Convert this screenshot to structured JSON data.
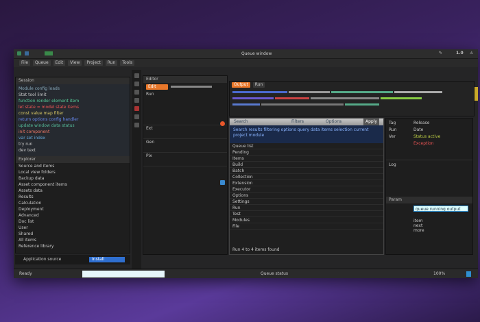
{
  "window": {
    "title": "Queue window",
    "title_icons": [
      "edit-icon",
      "user-icon",
      "alert-icon"
    ],
    "badge": "1.0"
  },
  "menu": [
    "File",
    "Queue",
    "Edit",
    "View",
    "Project",
    "Run",
    "Tools"
  ],
  "left": {
    "header": "Session",
    "tab": "Explorer",
    "code": [
      "Module config loads",
      "Stat tool limit",
      "function render element item",
      "let state = model state items",
      "const value map filter",
      "return options config handler",
      "update window data status",
      "init component",
      "var set index",
      "try run",
      "dev text"
    ],
    "tree": [
      "Source and items",
      "Local view folders",
      "Backup data",
      "Asset component items",
      "Assets data",
      "Results",
      "Calculation",
      "Deployment",
      "Advanced",
      "Doc list",
      "User",
      "Shared",
      "All items",
      "Reference library"
    ],
    "footer": "Application source",
    "footer_button": "Install"
  },
  "middle": {
    "header": "Editor",
    "tab": "Edit",
    "labels": [
      "Run",
      "Ext",
      "Gen",
      "Pix"
    ],
    "colors": {
      "accent": "#e8772a"
    }
  },
  "center": {
    "header": "Queue window",
    "tab": "Output",
    "tab2": "Run",
    "dialog": {
      "tabs": [
        "Search",
        "Filters",
        "Options"
      ],
      "button": "Apply",
      "selected": "Search results filtering options query data items selection current project module",
      "items": [
        "Queue list",
        "Pending",
        "Items",
        "Build",
        "Batch",
        "Collection",
        "Extension",
        "Executor",
        "Options",
        "Settings",
        "Run",
        "Test",
        "Modules",
        "File"
      ],
      "footer": "Run 4 to 4 items found"
    }
  },
  "right": {
    "labels": [
      "Tag",
      "Run",
      "Ver",
      "Log",
      "Param"
    ],
    "values": [
      "Release",
      "Date",
      "Status active",
      "Exception"
    ],
    "input": "queue running output value",
    "list": [
      "item",
      "next",
      "more"
    ]
  },
  "status": {
    "left": "Ready",
    "center": "Queue status",
    "right": "100%"
  },
  "colors": {
    "bg": "#252526",
    "blue": "#2f6fd0",
    "orange": "#e8772a",
    "green": "#3fa85a",
    "purple": "#5a3a9a"
  }
}
